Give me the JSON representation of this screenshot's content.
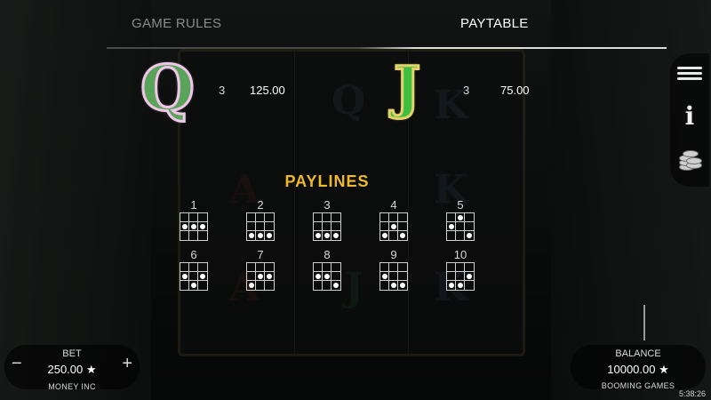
{
  "tabs": {
    "rules": "GAME RULES",
    "paytable": "PAYTABLE"
  },
  "paytable": {
    "q": {
      "symbol": "Q",
      "count": "3",
      "value": "125.00"
    },
    "j": {
      "symbol": "J",
      "count": "3",
      "value": "75.00"
    }
  },
  "paylines": {
    "title": "PAYLINES",
    "lines": [
      {
        "num": "1",
        "cells": [
          0,
          0,
          0,
          1,
          1,
          1,
          0,
          0,
          0
        ]
      },
      {
        "num": "2",
        "cells": [
          0,
          0,
          0,
          0,
          0,
          0,
          1,
          1,
          1
        ]
      },
      {
        "num": "3",
        "cells": [
          0,
          0,
          0,
          0,
          0,
          0,
          1,
          1,
          1
        ]
      },
      {
        "num": "4",
        "cells": [
          0,
          0,
          0,
          0,
          1,
          0,
          1,
          0,
          1
        ]
      },
      {
        "num": "5",
        "cells": [
          0,
          1,
          0,
          1,
          0,
          0,
          0,
          0,
          1
        ]
      },
      {
        "num": "6",
        "cells": [
          0,
          0,
          0,
          1,
          0,
          1,
          0,
          1,
          0
        ]
      },
      {
        "num": "7",
        "cells": [
          0,
          0,
          0,
          0,
          1,
          1,
          1,
          0,
          0
        ]
      },
      {
        "num": "8",
        "cells": [
          0,
          0,
          0,
          1,
          1,
          0,
          0,
          0,
          1
        ]
      },
      {
        "num": "9",
        "cells": [
          0,
          0,
          0,
          1,
          0,
          0,
          0,
          1,
          1
        ]
      },
      {
        "num": "10",
        "cells": [
          0,
          0,
          0,
          0,
          0,
          1,
          1,
          1,
          0
        ]
      }
    ]
  },
  "icons": {
    "menu": "hamburger-icon",
    "info": "info-icon",
    "coins": "coins-icon"
  },
  "bet": {
    "label": "BET",
    "value": "250.00 ★",
    "minus": "−",
    "plus": "+"
  },
  "game_name": "MONEY INC",
  "balance": {
    "label": "BALANCE",
    "value": "10000.00 ★"
  },
  "brand": "BOOMING GAMES",
  "clock": "5:38:26",
  "colors": {
    "paylines_title": "#f0b92a",
    "tab_active": "#ffffff",
    "tab_inactive": "#8a8a8a"
  }
}
